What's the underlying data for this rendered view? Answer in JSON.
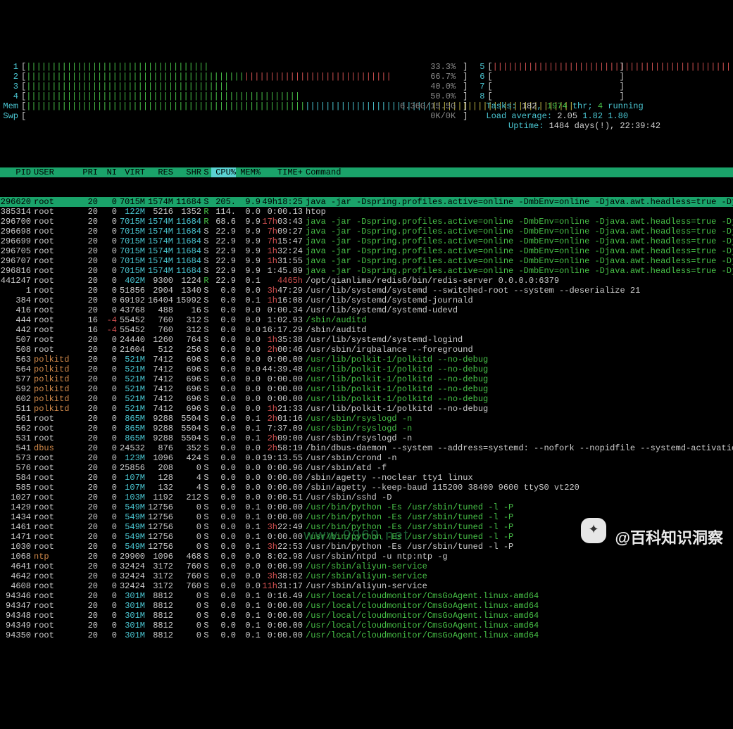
{
  "header": {
    "cpus": [
      {
        "n": "1",
        "bar": "||||||||||||||||||||||||||||||||||||",
        "pct": "33.3%",
        "c": "green"
      },
      {
        "n": "2",
        "bar": "||||||||||||||||||||||||||||||||||||||||||||||||||||||||||||||||||||||||",
        "pct": "66.7%",
        "c": "mixed"
      },
      {
        "n": "3",
        "bar": "||||||||||||||||||||||||||||||||||||||||",
        "pct": "40.0%",
        "c": "green"
      },
      {
        "n": "4",
        "bar": "||||||||||||||||||||||||||||||||||||||||||||||||||||||",
        "pct": "50.0%",
        "c": "green"
      },
      {
        "n": "5",
        "bar": "||||||||||||||||||||||||||||||||||||||||||||||||||||||||||||||||||||||||||||||||||||||||||||||||||||",
        "pct": "",
        "c": "red"
      },
      {
        "n": "6",
        "bar": "",
        "pct": "",
        "c": ""
      },
      {
        "n": "7",
        "bar": "",
        "pct": "",
        "c": ""
      },
      {
        "n": "8",
        "bar": "",
        "pct": "",
        "c": ""
      }
    ],
    "mem_label": "Mem",
    "mem_bar": "||||||||||||||||||||||||||||||||||||||||||||||||||||||||||||||||||||||||||||||||||||||||||||||||||||||||||||",
    "mem_val": "6.36G/15.5G",
    "swp_label": "Swp",
    "swp_bar": "",
    "swp_val": "0K/0K",
    "tasks_label": "Tasks:",
    "tasks_procs": "182",
    "tasks_thr": "1974",
    "tasks_thr_label": "thr;",
    "tasks_running": "4",
    "tasks_running_label": "running",
    "load_label": "Load average:",
    "load1": "2.05",
    "load5": "1.82",
    "load15": "1.80",
    "uptime_label": "Uptime:",
    "uptime": "1484 days(!), 22:39:42"
  },
  "cols": {
    "pid": "PID",
    "user": "USER",
    "pri": "PRI",
    "ni": "NI",
    "virt": "VIRT",
    "res": "RES",
    "shr": "SHR",
    "s": "S",
    "cpu": "CPU%",
    "mem": "MEM%",
    "time": "TIME+",
    "cmd": "Command"
  },
  "procs": [
    {
      "pid": "296620",
      "user": "root",
      "pri": "20",
      "ni": "0",
      "virt": "7015M",
      "res": "1574M",
      "shr": "11684",
      "s": "S",
      "cpu": "205.",
      "mem": "9.9",
      "time": "49h18:25",
      "cmd": "java -jar -Dspring.profiles.active=online -DmbEnv=online -Djava.awt.headless=true -Djava.n",
      "sel": true
    },
    {
      "pid": "385314",
      "user": "root",
      "pri": "20",
      "ni": "0",
      "virt": "122M",
      "res": "5216",
      "shr": "1352",
      "s": "R",
      "cpu": "114.",
      "mem": "0.0",
      "time": "0:00.13",
      "cmd": "htop",
      "cmd_col": "white"
    },
    {
      "pid": "296700",
      "user": "root",
      "pri": "20",
      "ni": "0",
      "virt": "7015M",
      "res": "1574M",
      "shr": "11684",
      "s": "R",
      "cpu": "68.6",
      "mem": "9.9",
      "time": "17h03:43",
      "time_col": "red",
      "cmd": "java -jar -Dspring.profiles.active=online -DmbEnv=online -Djava.awt.headless=true -Djava.n",
      "cmd_col": "green"
    },
    {
      "pid": "296698",
      "user": "root",
      "pri": "20",
      "ni": "0",
      "virt": "7015M",
      "res": "1574M",
      "shr": "11684",
      "s": "S",
      "cpu": "22.9",
      "mem": "9.9",
      "time": "7h09:27",
      "time_col": "red",
      "cmd": "java -jar -Dspring.profiles.active=online -DmbEnv=online -Djava.awt.headless=true -Djava.n",
      "cmd_col": "green"
    },
    {
      "pid": "296699",
      "user": "root",
      "pri": "20",
      "ni": "0",
      "virt": "7015M",
      "res": "1574M",
      "shr": "11684",
      "s": "S",
      "cpu": "22.9",
      "mem": "9.9",
      "time": "7h15:47",
      "time_col": "red",
      "cmd": "java -jar -Dspring.profiles.active=online -DmbEnv=online -Djava.awt.headless=true -Djava.n",
      "cmd_col": "green"
    },
    {
      "pid": "296705",
      "user": "root",
      "pri": "20",
      "ni": "0",
      "virt": "7015M",
      "res": "1574M",
      "shr": "11684",
      "s": "S",
      "cpu": "22.9",
      "mem": "9.9",
      "time": "1h32:24",
      "time_col": "red",
      "cmd": "java -jar -Dspring.profiles.active=online -DmbEnv=online -Djava.awt.headless=true -Djava.n",
      "cmd_col": "green"
    },
    {
      "pid": "296707",
      "user": "root",
      "pri": "20",
      "ni": "0",
      "virt": "7015M",
      "res": "1574M",
      "shr": "11684",
      "s": "S",
      "cpu": "22.9",
      "mem": "9.9",
      "time": "1h31:55",
      "time_col": "red",
      "cmd": "java -jar -Dspring.profiles.active=online -DmbEnv=online -Djava.awt.headless=true -Djava.n",
      "cmd_col": "green"
    },
    {
      "pid": "296816",
      "user": "root",
      "pri": "20",
      "ni": "0",
      "virt": "7015M",
      "res": "1574M",
      "shr": "11684",
      "s": "S",
      "cpu": "22.9",
      "mem": "9.9",
      "time": "1:45.89",
      "cmd": "java -jar -Dspring.profiles.active=online -DmbEnv=online -Djava.awt.headless=true -Djava.n",
      "cmd_col": "green"
    },
    {
      "pid": "441247",
      "user": "root",
      "pri": "20",
      "ni": "0",
      "virt": "402M",
      "res": "9300",
      "shr": "1224",
      "s": "R",
      "cpu": "22.9",
      "mem": "0.1",
      "time": "4465h",
      "time_col": "red",
      "cmd": "/opt/qianlima/redis6/bin/redis-server 0.0.0.0:6379",
      "cmd_col": "white"
    },
    {
      "pid": "1",
      "user": "root",
      "pri": "20",
      "ni": "0",
      "virt": "51856",
      "res": "2904",
      "shr": "1340",
      "s": "S",
      "cpu": "0.0",
      "mem": "0.0",
      "time": "3h47:29",
      "time_col": "red",
      "cmd": "/usr/lib/systemd/systemd --switched-root --system --deserialize 21",
      "cmd_col": "white"
    },
    {
      "pid": "384",
      "user": "root",
      "pri": "20",
      "ni": "0",
      "virt": "69192",
      "res": "16404",
      "shr": "15992",
      "s": "S",
      "cpu": "0.0",
      "mem": "0.1",
      "time": "1h16:08",
      "time_col": "red",
      "cmd": "/usr/lib/systemd/systemd-journald",
      "cmd_col": "white"
    },
    {
      "pid": "416",
      "user": "root",
      "pri": "20",
      "ni": "0",
      "virt": "43768",
      "res": "488",
      "shr": "16",
      "s": "S",
      "cpu": "0.0",
      "mem": "0.0",
      "time": "0:00.34",
      "cmd": "/usr/lib/systemd/systemd-udevd",
      "cmd_col": "white"
    },
    {
      "pid": "444",
      "user": "root",
      "pri": "16",
      "ni": "-4",
      "virt": "55452",
      "res": "760",
      "shr": "312",
      "s": "S",
      "cpu": "0.0",
      "mem": "0.0",
      "time": "1:02.93",
      "cmd": "/sbin/auditd",
      "cmd_col": "green"
    },
    {
      "pid": "442",
      "user": "root",
      "pri": "16",
      "ni": "-4",
      "virt": "55452",
      "res": "760",
      "shr": "312",
      "s": "S",
      "cpu": "0.0",
      "mem": "0.0",
      "time": "16:17.29",
      "cmd": "/sbin/auditd",
      "cmd_col": "white"
    },
    {
      "pid": "507",
      "user": "root",
      "pri": "20",
      "ni": "0",
      "virt": "24440",
      "res": "1260",
      "shr": "764",
      "s": "S",
      "cpu": "0.0",
      "mem": "0.0",
      "time": "1h35:38",
      "time_col": "red",
      "cmd": "/usr/lib/systemd/systemd-logind",
      "cmd_col": "white"
    },
    {
      "pid": "508",
      "user": "root",
      "pri": "20",
      "ni": "0",
      "virt": "21604",
      "res": "512",
      "shr": "256",
      "s": "S",
      "cpu": "0.0",
      "mem": "0.0",
      "time": "2h00:46",
      "time_col": "red",
      "cmd": "/usr/sbin/irqbalance --foreground",
      "cmd_col": "white"
    },
    {
      "pid": "563",
      "user": "polkitd",
      "pri": "20",
      "ni": "0",
      "virt": "521M",
      "res": "7412",
      "shr": "696",
      "s": "S",
      "cpu": "0.0",
      "mem": "0.0",
      "time": "0:00.00",
      "cmd": "/usr/lib/polkit-1/polkitd --no-debug",
      "cmd_col": "green"
    },
    {
      "pid": "564",
      "user": "polkitd",
      "pri": "20",
      "ni": "0",
      "virt": "521M",
      "res": "7412",
      "shr": "696",
      "s": "S",
      "cpu": "0.0",
      "mem": "0.0",
      "time": "44:39.48",
      "cmd": "/usr/lib/polkit-1/polkitd --no-debug",
      "cmd_col": "green"
    },
    {
      "pid": "577",
      "user": "polkitd",
      "pri": "20",
      "ni": "0",
      "virt": "521M",
      "res": "7412",
      "shr": "696",
      "s": "S",
      "cpu": "0.0",
      "mem": "0.0",
      "time": "0:00.00",
      "cmd": "/usr/lib/polkit-1/polkitd --no-debug",
      "cmd_col": "green"
    },
    {
      "pid": "592",
      "user": "polkitd",
      "pri": "20",
      "ni": "0",
      "virt": "521M",
      "res": "7412",
      "shr": "696",
      "s": "S",
      "cpu": "0.0",
      "mem": "0.0",
      "time": "0:00.00",
      "cmd": "/usr/lib/polkit-1/polkitd --no-debug",
      "cmd_col": "green"
    },
    {
      "pid": "602",
      "user": "polkitd",
      "pri": "20",
      "ni": "0",
      "virt": "521M",
      "res": "7412",
      "shr": "696",
      "s": "S",
      "cpu": "0.0",
      "mem": "0.0",
      "time": "0:00.00",
      "cmd": "/usr/lib/polkit-1/polkitd --no-debug",
      "cmd_col": "green"
    },
    {
      "pid": "511",
      "user": "polkitd",
      "pri": "20",
      "ni": "0",
      "virt": "521M",
      "res": "7412",
      "shr": "696",
      "s": "S",
      "cpu": "0.0",
      "mem": "0.0",
      "time": "1h21:33",
      "time_col": "red",
      "cmd": "/usr/lib/polkit-1/polkitd --no-debug",
      "cmd_col": "white"
    },
    {
      "pid": "561",
      "user": "root",
      "pri": "20",
      "ni": "0",
      "virt": "865M",
      "res": "9288",
      "shr": "5504",
      "s": "S",
      "cpu": "0.0",
      "mem": "0.1",
      "time": "2h01:16",
      "time_col": "red",
      "cmd": "/usr/sbin/rsyslogd -n",
      "cmd_col": "green"
    },
    {
      "pid": "562",
      "user": "root",
      "pri": "20",
      "ni": "0",
      "virt": "865M",
      "res": "9288",
      "shr": "5504",
      "s": "S",
      "cpu": "0.0",
      "mem": "0.1",
      "time": "7:37.09",
      "cmd": "/usr/sbin/rsyslogd -n",
      "cmd_col": "green"
    },
    {
      "pid": "531",
      "user": "root",
      "pri": "20",
      "ni": "0",
      "virt": "865M",
      "res": "9288",
      "shr": "5504",
      "s": "S",
      "cpu": "0.0",
      "mem": "0.1",
      "time": "2h09:00",
      "time_col": "red",
      "cmd": "/usr/sbin/rsyslogd -n",
      "cmd_col": "white"
    },
    {
      "pid": "541",
      "user": "dbus",
      "pri": "20",
      "ni": "0",
      "virt": "24532",
      "res": "876",
      "shr": "352",
      "s": "S",
      "cpu": "0.0",
      "mem": "0.0",
      "time": "2h58:19",
      "time_col": "red",
      "cmd": "/bin/dbus-daemon --system --address=systemd: --nofork --nopidfile --systemd-activation",
      "cmd_col": "white"
    },
    {
      "pid": "573",
      "user": "root",
      "pri": "20",
      "ni": "0",
      "virt": "123M",
      "res": "1096",
      "shr": "424",
      "s": "S",
      "cpu": "0.0",
      "mem": "0.0",
      "time": "19:13.55",
      "cmd": "/usr/sbin/crond -n",
      "cmd_col": "white"
    },
    {
      "pid": "576",
      "user": "root",
      "pri": "20",
      "ni": "0",
      "virt": "25856",
      "res": "208",
      "shr": "0",
      "s": "S",
      "cpu": "0.0",
      "mem": "0.0",
      "time": "0:00.96",
      "cmd": "/usr/sbin/atd -f",
      "cmd_col": "white"
    },
    {
      "pid": "584",
      "user": "root",
      "pri": "20",
      "ni": "0",
      "virt": "107M",
      "res": "128",
      "shr": "4",
      "s": "S",
      "cpu": "0.0",
      "mem": "0.0",
      "time": "0:00.00",
      "cmd": "/sbin/agetty --noclear tty1 linux",
      "cmd_col": "white"
    },
    {
      "pid": "585",
      "user": "root",
      "pri": "20",
      "ni": "0",
      "virt": "107M",
      "res": "132",
      "shr": "4",
      "s": "S",
      "cpu": "0.0",
      "mem": "0.0",
      "time": "0:00.00",
      "cmd": "/sbin/agetty --keep-baud 115200 38400 9600 ttyS0 vt220",
      "cmd_col": "white"
    },
    {
      "pid": "1027",
      "user": "root",
      "pri": "20",
      "ni": "0",
      "virt": "103M",
      "res": "1192",
      "shr": "212",
      "s": "S",
      "cpu": "0.0",
      "mem": "0.0",
      "time": "0:00.51",
      "cmd": "/usr/sbin/sshd -D",
      "cmd_col": "white"
    },
    {
      "pid": "1429",
      "user": "root",
      "pri": "20",
      "ni": "0",
      "virt": "549M",
      "res": "12756",
      "shr": "0",
      "s": "S",
      "cpu": "0.0",
      "mem": "0.1",
      "time": "0:00.00",
      "cmd": "/usr/bin/python -Es /usr/sbin/tuned -l -P",
      "cmd_col": "green"
    },
    {
      "pid": "1434",
      "user": "root",
      "pri": "20",
      "ni": "0",
      "virt": "549M",
      "res": "12756",
      "shr": "0",
      "s": "S",
      "cpu": "0.0",
      "mem": "0.1",
      "time": "0:00.00",
      "cmd": "/usr/bin/python -Es /usr/sbin/tuned -l -P",
      "cmd_col": "green"
    },
    {
      "pid": "1461",
      "user": "root",
      "pri": "20",
      "ni": "0",
      "virt": "549M",
      "res": "12756",
      "shr": "0",
      "s": "S",
      "cpu": "0.0",
      "mem": "0.1",
      "time": "3h22:49",
      "time_col": "red",
      "cmd": "/usr/bin/python -Es /usr/sbin/tuned -l -P",
      "cmd_col": "green"
    },
    {
      "pid": "1471",
      "user": "root",
      "pri": "20",
      "ni": "0",
      "virt": "549M",
      "res": "12756",
      "shr": "0",
      "s": "S",
      "cpu": "0.0",
      "mem": "0.1",
      "time": "0:00.00",
      "cmd": "/usr/bin/python -Es /usr/sbin/tuned -l -P",
      "cmd_col": "green"
    },
    {
      "pid": "1030",
      "user": "root",
      "pri": "20",
      "ni": "0",
      "virt": "549M",
      "res": "12756",
      "shr": "0",
      "s": "S",
      "cpu": "0.0",
      "mem": "0.1",
      "time": "3h22:53",
      "time_col": "red",
      "cmd": "/usr/bin/python -Es /usr/sbin/tuned -l -P",
      "cmd_col": "white"
    },
    {
      "pid": "1068",
      "user": "ntp",
      "pri": "20",
      "ni": "0",
      "virt": "29900",
      "res": "1096",
      "shr": "468",
      "s": "S",
      "cpu": "0.0",
      "mem": "0.0",
      "time": "8:02.98",
      "cmd": "/usr/sbin/ntpd -u ntp:ntp -g",
      "cmd_col": "white"
    },
    {
      "pid": "4641",
      "user": "root",
      "pri": "20",
      "ni": "0",
      "virt": "32424",
      "res": "3172",
      "shr": "760",
      "s": "S",
      "cpu": "0.0",
      "mem": "0.0",
      "time": "0:00.99",
      "cmd": "/usr/sbin/aliyun-service",
      "cmd_col": "green"
    },
    {
      "pid": "4642",
      "user": "root",
      "pri": "20",
      "ni": "0",
      "virt": "32424",
      "res": "3172",
      "shr": "760",
      "s": "S",
      "cpu": "0.0",
      "mem": "0.0",
      "time": "3h38:02",
      "time_col": "red",
      "cmd": "/usr/sbin/aliyun-service",
      "cmd_col": "green"
    },
    {
      "pid": "4608",
      "user": "root",
      "pri": "20",
      "ni": "0",
      "virt": "32424",
      "res": "3172",
      "shr": "760",
      "s": "S",
      "cpu": "0.0",
      "mem": "0.0",
      "time": "11h31:17",
      "time_col": "red",
      "cmd": "/usr/sbin/aliyun-service",
      "cmd_col": "white"
    },
    {
      "pid": "94346",
      "user": "root",
      "pri": "20",
      "ni": "0",
      "virt": "301M",
      "res": "8812",
      "shr": "0",
      "s": "S",
      "cpu": "0.0",
      "mem": "0.1",
      "time": "0:16.49",
      "cmd": "/usr/local/cloudmonitor/CmsGoAgent.linux-amd64",
      "cmd_col": "green"
    },
    {
      "pid": "94347",
      "user": "root",
      "pri": "20",
      "ni": "0",
      "virt": "301M",
      "res": "8812",
      "shr": "0",
      "s": "S",
      "cpu": "0.0",
      "mem": "0.1",
      "time": "0:00.00",
      "cmd": "/usr/local/cloudmonitor/CmsGoAgent.linux-amd64",
      "cmd_col": "green"
    },
    {
      "pid": "94348",
      "user": "root",
      "pri": "20",
      "ni": "0",
      "virt": "301M",
      "res": "8812",
      "shr": "0",
      "s": "S",
      "cpu": "0.0",
      "mem": "0.1",
      "time": "0:00.00",
      "cmd": "/usr/local/cloudmonitor/CmsGoAgent.linux-amd64",
      "cmd_col": "green"
    },
    {
      "pid": "94349",
      "user": "root",
      "pri": "20",
      "ni": "0",
      "virt": "301M",
      "res": "8812",
      "shr": "0",
      "s": "S",
      "cpu": "0.0",
      "mem": "0.1",
      "time": "0:00.00",
      "cmd": "/usr/local/cloudmonitor/CmsGoAgent.linux-amd64",
      "cmd_col": "green"
    },
    {
      "pid": "94350",
      "user": "root",
      "pri": "20",
      "ni": "0",
      "virt": "301M",
      "res": "8812",
      "shr": "0",
      "s": "S",
      "cpu": "0.0",
      "mem": "0.1",
      "time": "0:00.00",
      "cmd": "/usr/local/cloudmonitor/CmsGoAgent.linux-amd64",
      "cmd_col": "green"
    }
  ],
  "watermark": {
    "url": "www.9969.net",
    "logo_glyph": "✦",
    "text": "@百科知识洞察"
  }
}
